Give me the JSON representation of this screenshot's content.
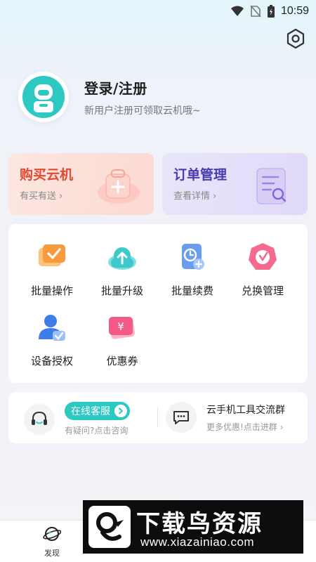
{
  "status": {
    "time": "10:59"
  },
  "profile": {
    "title": "登录/注册",
    "subtitle": "新用户注册可领取云机哦~"
  },
  "quick_cards": [
    {
      "title": "购买云机",
      "subtitle": "有买有送 ›"
    },
    {
      "title": "订单管理",
      "subtitle": "查看详情 ›"
    }
  ],
  "grid": [
    {
      "label": "批量操作",
      "icon": "batch-check-icon"
    },
    {
      "label": "批量升级",
      "icon": "cloud-upload-icon"
    },
    {
      "label": "批量续费",
      "icon": "clock-renew-icon"
    },
    {
      "label": "兑换管理",
      "icon": "redeem-icon"
    },
    {
      "label": "设备授权",
      "icon": "user-auth-icon"
    },
    {
      "label": "优惠券",
      "icon": "coupon-icon"
    }
  ],
  "service": {
    "online": {
      "label": "在线客服",
      "subtitle": "有疑问?点击咨询"
    },
    "group": {
      "title": "云手机工具交流群",
      "subtitle": "更多优惠!点击进群 ›"
    }
  },
  "nav": {
    "discover": "发现"
  },
  "watermark": {
    "title": "下载鸟资源",
    "url": "www.xiazainiao.com"
  },
  "colors": {
    "accent": "#2cc9c3",
    "buy": "#e24a32",
    "order": "#4a3ab0"
  }
}
